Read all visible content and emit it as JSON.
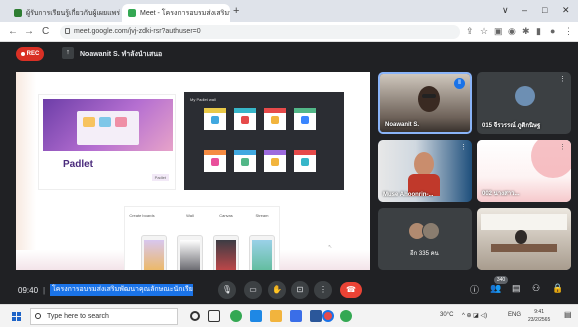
{
  "browser": {
    "tabs": [
      {
        "title": "ผู้รับการเรียนรู้เกี่ยวกับผู้เผยแพร่",
        "active": false
      },
      {
        "title": "Meet - โครงการอบรมส่งเสริมฯ",
        "active": true
      }
    ],
    "new_tab": "+",
    "window_controls": {
      "minimize": "∨",
      "min2": "–",
      "max": "□",
      "close": "✕"
    },
    "url": "meet.google.com/jvj-zdki-rsr?authuser=0",
    "nav": {
      "back": "←",
      "forward": "→",
      "reload": "C"
    }
  },
  "meet": {
    "rec_label": "REC",
    "presenter": "Noawanit S. ทำลังนำเสนอ",
    "slide": {
      "padlet_logo": "Padlet",
      "board_title": "My Padlet wall",
      "phone_labels": [
        "Create boards",
        "Wall",
        "Canvas",
        "Stream"
      ]
    },
    "tiles": [
      {
        "name": "Noawanit S.",
        "speaking": true
      },
      {
        "name": "015 จีรวรรณ์ ภูติกนิษฐ"
      },
      {
        "name": "Muse Ahoonrin-..."
      },
      {
        "name": "002 นางสาว..."
      },
      {
        "name": "อีก 335 คน"
      },
      {
        "name": ""
      }
    ],
    "controls": {
      "time": "09:40",
      "separator": "|",
      "meeting_title": "โครงการอบรมส่งเสริมพัฒนาคุณลักษณะนักเรียนที่...",
      "participants_count": "340",
      "end_icon": "☎",
      "mic_icon": "🎙",
      "cam_icon": "▭",
      "hand_icon": "✋",
      "present_icon": "⊡",
      "more_icon": "⋮",
      "info_icon": "ⓘ",
      "people_icon": "👥",
      "chat_icon": "▤",
      "activities_icon": "⚇",
      "lock_icon": "🔒"
    }
  },
  "taskbar": {
    "search_placeholder": "Type here to search",
    "weather": "30°C",
    "lang": "ENG",
    "time": "9:41",
    "date": "23/2/2565"
  },
  "colors": {
    "meet_bg": "#202124",
    "accent": "#1a73e8",
    "rec": "#d93025",
    "end_call": "#ea4335"
  }
}
